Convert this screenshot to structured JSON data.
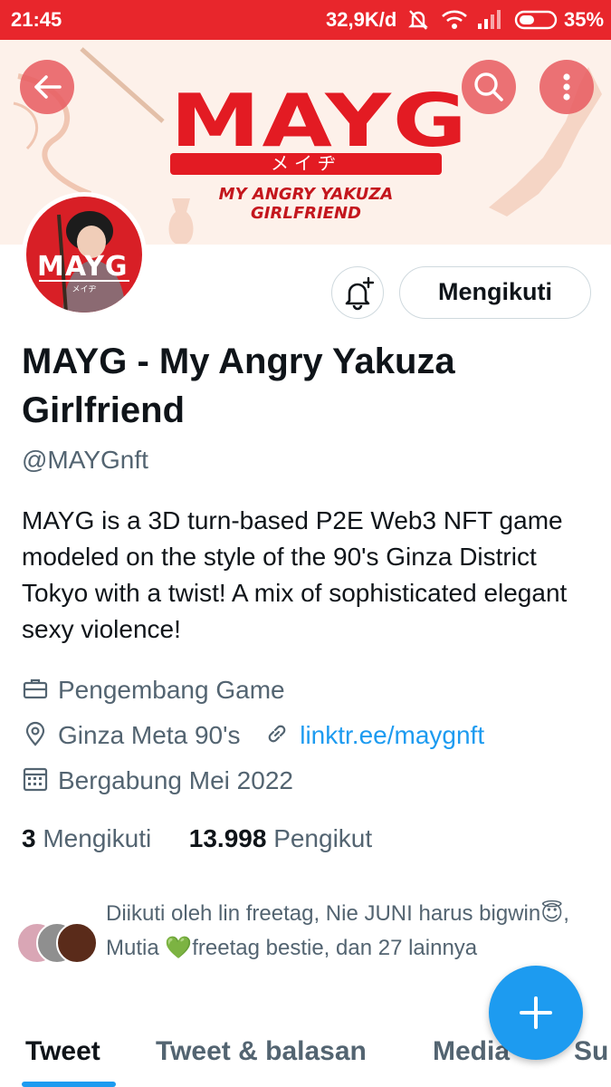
{
  "status_bar": {
    "time": "21:45",
    "network_speed": "32,9K/d",
    "battery": "35%",
    "icons": [
      "mute-icon",
      "wifi-icon",
      "signal-icon",
      "battery-icon"
    ]
  },
  "banner": {
    "logo_text": "MAYG",
    "logo_kana": "メイヂ",
    "logo_subtitle": "MY ANGRY YAKUZA GIRLFRIEND"
  },
  "header_buttons": {
    "back": "back-arrow-icon",
    "search": "search-icon",
    "more": "more-vertical-icon"
  },
  "profile": {
    "avatar_text": "MAYG",
    "avatar_kana": "メイヂ",
    "follow_button_label": "Mengikuti",
    "display_name": "MAYG - My Angry Yakuza Girlfriend",
    "handle": "@MAYGnft",
    "bio": "MAYG is a 3D turn-based P2E Web3 NFT game modeled on the style of the 90's Ginza District Tokyo with a twist! A mix of sophisticated elegant sexy violence!",
    "category": "Pengembang Game",
    "location": "Ginza Meta 90's",
    "link": "linktr.ee/maygnft",
    "joined": "Bergabung Mei 2022",
    "following_count": "3",
    "following_label": "Mengikuti",
    "followers_count": "13.998",
    "followers_label": "Pengikut"
  },
  "followed_by": {
    "text": "Diikuti oleh lin freetag, Nie JUNI harus bigwin😇, Mutia 💚freetag bestie, dan 27 lainnya"
  },
  "tabs": [
    "Tweet",
    "Tweet & balasan",
    "Media",
    "Su"
  ],
  "active_tab": "Tweet",
  "colors": {
    "status_bar": "#e8262c",
    "brand_red": "#e31b23",
    "accent_blue": "#1d9bf0",
    "muted_text": "#536471"
  }
}
